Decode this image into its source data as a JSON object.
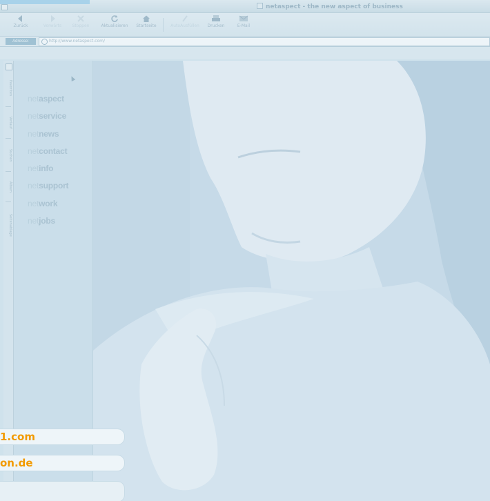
{
  "window": {
    "title": "netaspect - the new aspect of business"
  },
  "toolbar": {
    "buttons": [
      {
        "label": "Zurück",
        "icon": "back-arrow-icon",
        "enabled": true
      },
      {
        "label": "Vorwärts",
        "icon": "forward-arrow-icon",
        "enabled": false
      },
      {
        "label": "Stoppen",
        "icon": "stop-icon",
        "enabled": false
      },
      {
        "label": "Aktualisieren",
        "icon": "refresh-icon",
        "enabled": true
      },
      {
        "label": "Startseite",
        "icon": "home-icon",
        "enabled": true
      },
      {
        "label": "AutoAusfüllen",
        "icon": "autofill-icon",
        "enabled": false
      },
      {
        "label": "Drucken",
        "icon": "print-icon",
        "enabled": true
      },
      {
        "label": "E-Mail",
        "icon": "mail-icon",
        "enabled": true
      }
    ]
  },
  "address": {
    "label": "Adresse:",
    "url": "http://www.netaspect.com/"
  },
  "explorer_tabs": [
    "Favoriten",
    "Verlauf",
    "Suchen",
    "Album",
    "Seitenablage"
  ],
  "sidebar": {
    "items": [
      {
        "prefix": "net",
        "suffix": "aspect"
      },
      {
        "prefix": "net",
        "suffix": "service"
      },
      {
        "prefix": "net",
        "suffix": "news"
      },
      {
        "prefix": "net",
        "suffix": "contact"
      },
      {
        "prefix": "net",
        "suffix": "info"
      },
      {
        "prefix": "net",
        "suffix": "support"
      },
      {
        "prefix": "net",
        "suffix": "work"
      },
      {
        "prefix": "net",
        "suffix": "jobs"
      }
    ]
  },
  "overlay": {
    "lines": [
      "1.com",
      "on.de",
      ""
    ]
  },
  "colors": {
    "accent_orange": "#f29a00",
    "photo_tint": "#c4d9e8",
    "sidebar_bg": "#cadeea"
  }
}
